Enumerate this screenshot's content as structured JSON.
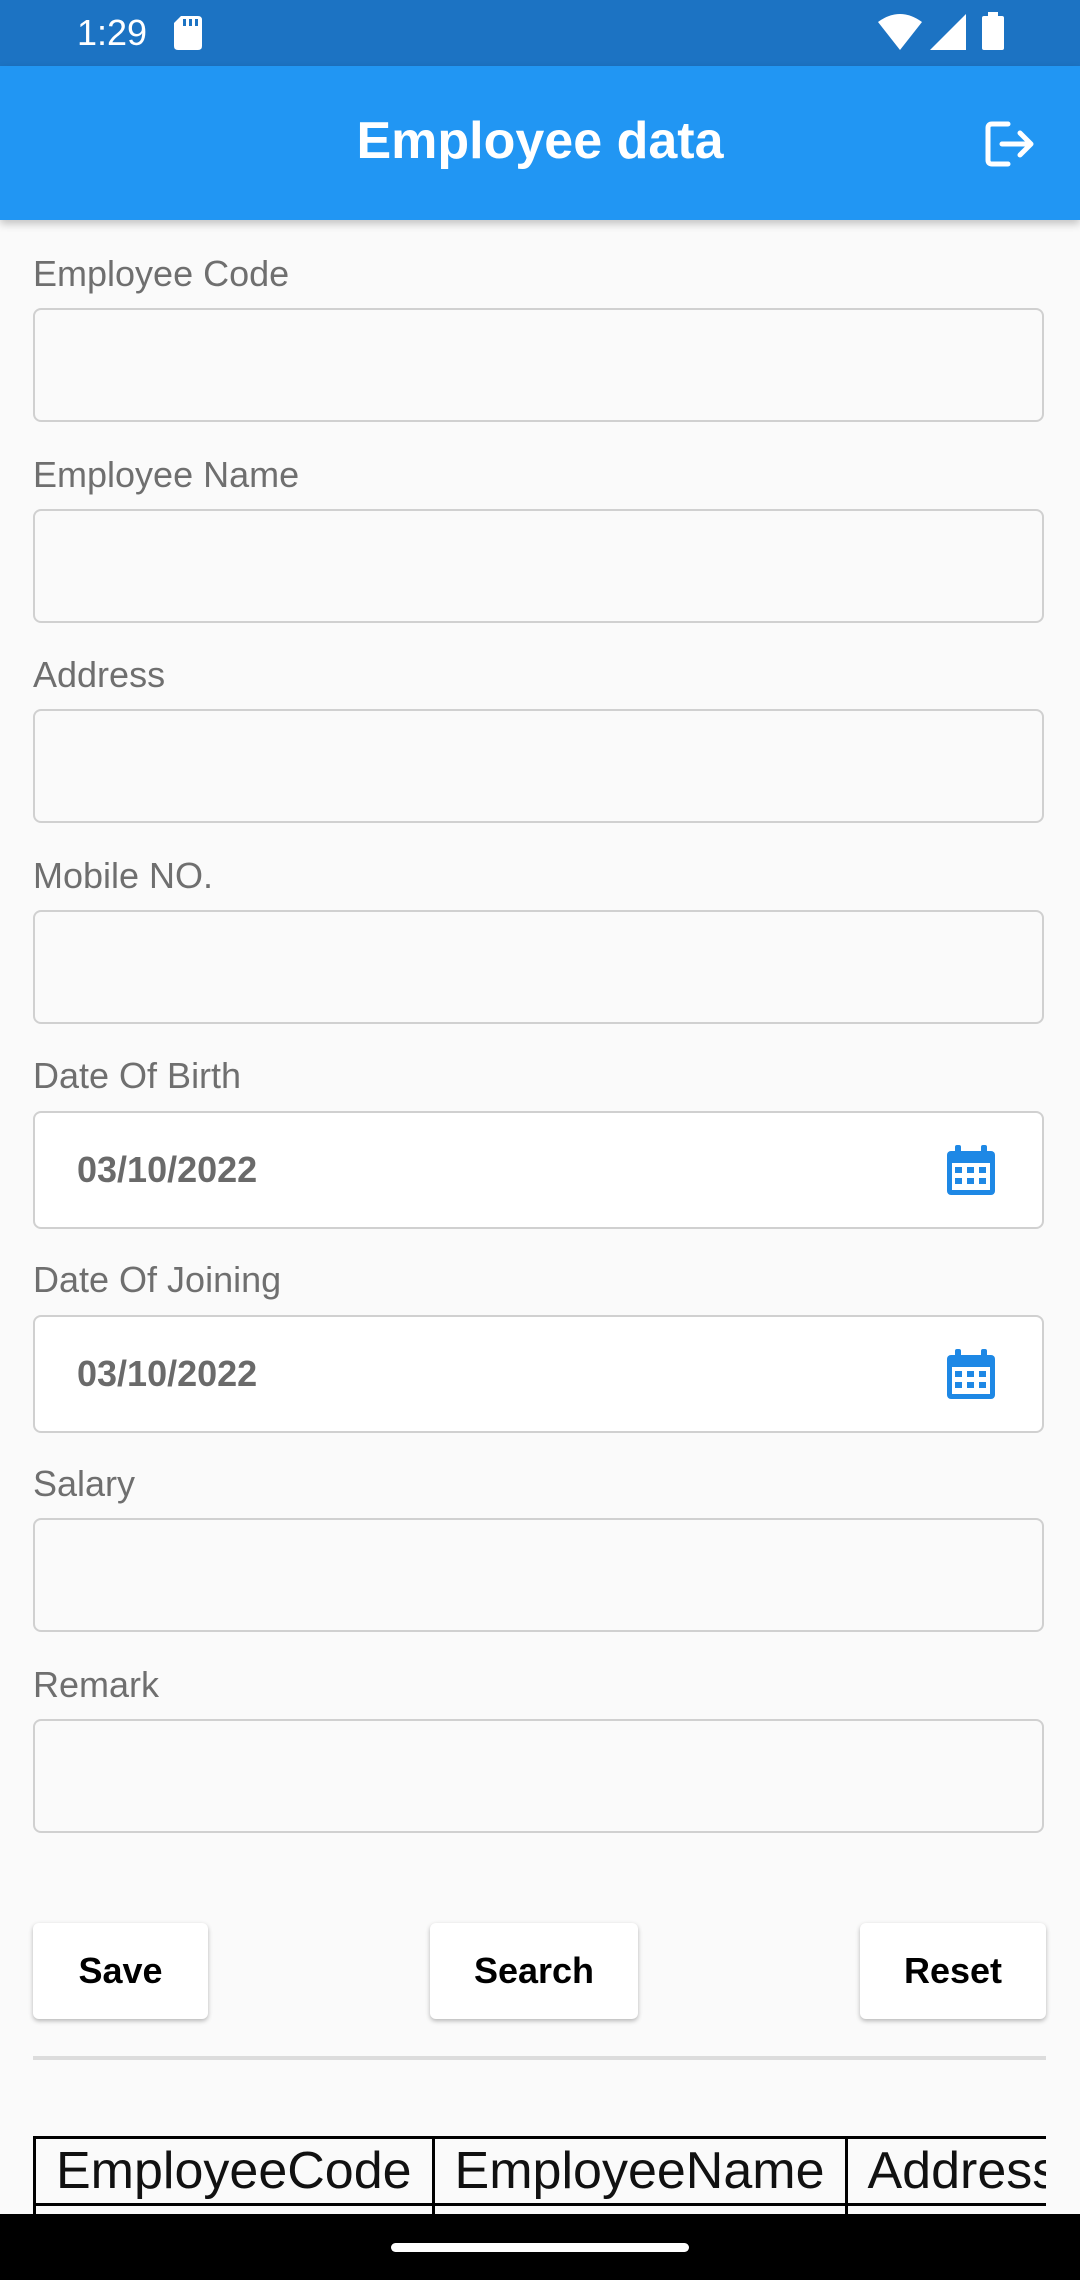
{
  "status_bar": {
    "time": "1:29"
  },
  "app_bar": {
    "title": "Employee data"
  },
  "form": {
    "employee_code": {
      "label": "Employee Code",
      "value": ""
    },
    "employee_name": {
      "label": "Employee Name",
      "value": ""
    },
    "address": {
      "label": "Address",
      "value": ""
    },
    "mobile_no": {
      "label": "Mobile NO.",
      "value": ""
    },
    "date_of_birth": {
      "label": "Date Of Birth",
      "value": "03/10/2022"
    },
    "date_of_joining": {
      "label": "Date Of Joining",
      "value": "03/10/2022"
    },
    "salary": {
      "label": "Salary",
      "value": ""
    },
    "remark": {
      "label": "Remark",
      "value": ""
    }
  },
  "buttons": {
    "save": "Save",
    "search": "Search",
    "reset": "Reset"
  },
  "table": {
    "headers": [
      "EmployeeCode",
      "EmployeeName",
      "Address"
    ]
  },
  "colors": {
    "status_bar": "#1c73c3",
    "app_bar": "#2196f3",
    "calendar_icon": "#1e88e5"
  }
}
